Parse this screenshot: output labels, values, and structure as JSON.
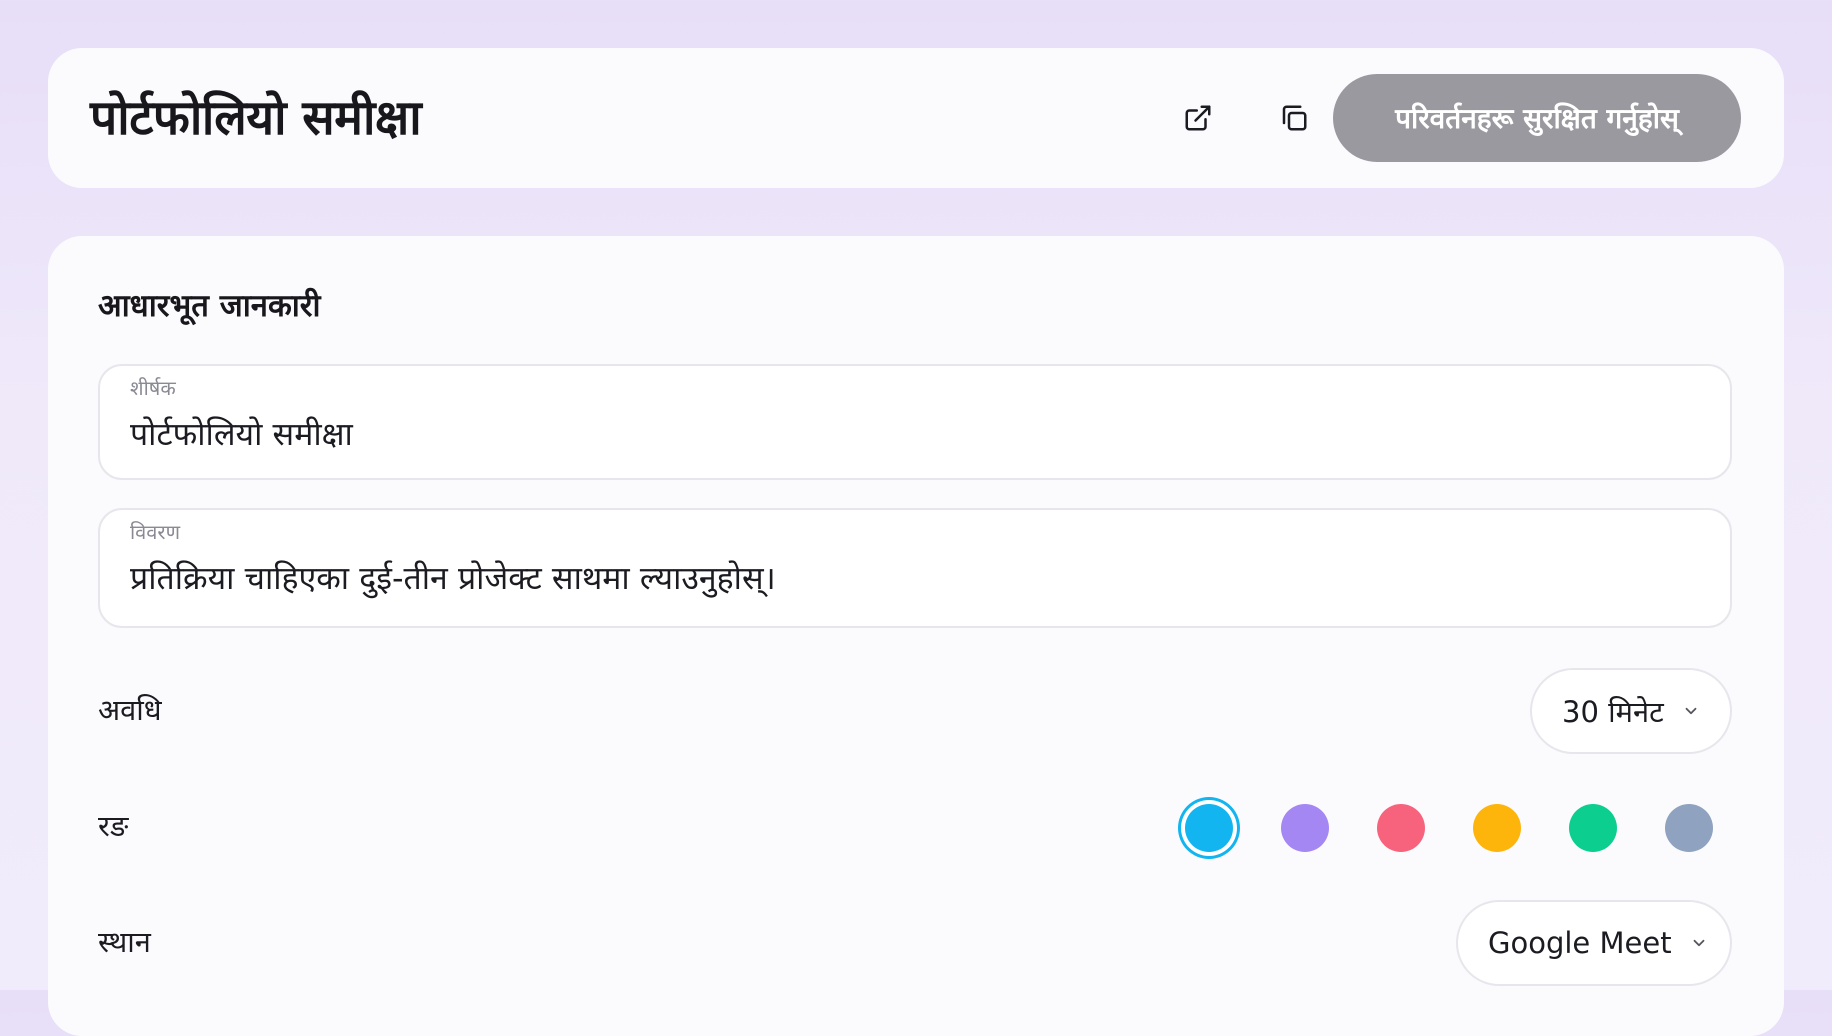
{
  "header": {
    "title": "पोर्टफोलियो समीक्षा",
    "open_icon": "external-link-icon",
    "copy_icon": "copy-icon",
    "save_label": "परिवर्तनहरू सुरक्षित गर्नुहोस्"
  },
  "basic_info": {
    "section_title": "आधारभूत जानकारी",
    "title_field": {
      "label": "शीर्षक",
      "value": "पोर्टफोलियो समीक्षा"
    },
    "description_field": {
      "label": "विवरण",
      "value": "प्रतिक्रिया चाहिएका दुई-तीन प्रोजेक्ट साथमा ल्याउनुहोस्।"
    },
    "duration": {
      "label": "अवधि",
      "value": "30 मिनेट",
      "icon": "chevron-down-icon"
    },
    "color": {
      "label": "रङ",
      "selected_index": 0,
      "options": [
        "#12b5ef",
        "#a487f3",
        "#f7637c",
        "#fdb50c",
        "#0bce8f",
        "#8fa2bf"
      ]
    },
    "location": {
      "label": "स्थान",
      "value": "Google Meet",
      "icon": "chevron-down-icon"
    }
  }
}
